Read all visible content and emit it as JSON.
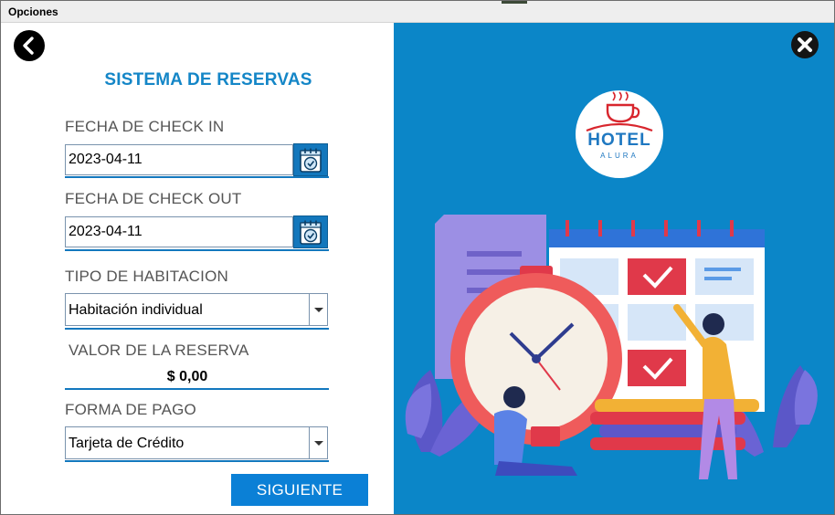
{
  "window": {
    "title": "Opciones"
  },
  "form": {
    "heading": "SISTEMA DE RESERVAS",
    "checkin_label": "FECHA DE CHECK IN",
    "checkin_value": "2023-04-11",
    "checkout_label": "FECHA DE CHECK OUT",
    "checkout_value": "2023-04-11",
    "room_type_label": "TIPO DE HABITACION",
    "room_type_value": "Habitación individual",
    "reservation_value_label": "VALOR DE LA RESERVA",
    "reservation_value": "$ 0,00",
    "payment_label": "FORMA DE PAGO",
    "payment_value": "Tarjeta de Crédito",
    "next_button": "SIGUIENTE"
  },
  "logo": {
    "main": "HOTEL",
    "sub": "ALURA"
  },
  "icons": {
    "back": "back-arrow-icon",
    "close": "close-icon",
    "calendar": "calendar-icon",
    "dropdown": "chevron-down-icon"
  },
  "colors": {
    "accent": "#1486c7",
    "panel": "#0b86c8",
    "button": "#0b80d6",
    "underline": "#1378be",
    "logo_red": "#d8262e"
  }
}
